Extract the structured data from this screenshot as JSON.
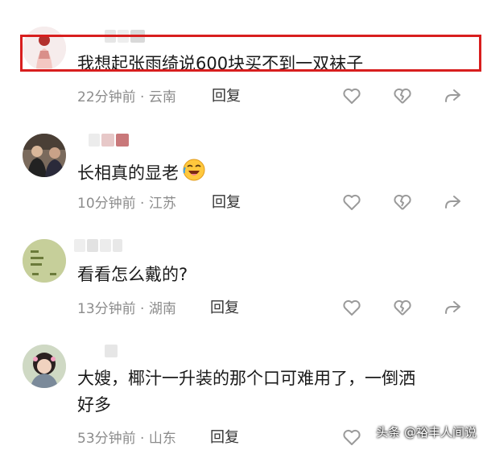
{
  "comments": [
    {
      "text": "我想起张雨绮说600块买不到一双袜子",
      "time": "22分钟前",
      "location": "云南",
      "reply_label": "回复"
    },
    {
      "text": "长相真的显老",
      "emoji": "laughing-crying-emoji",
      "time": "10分钟前",
      "location": "江苏",
      "reply_label": "回复"
    },
    {
      "text": "看看怎么戴的?",
      "time": "13分钟前",
      "location": "湖南",
      "reply_label": "回复"
    },
    {
      "text_line1": "大嫂，椰汁一升装的那个口可难用了，一倒洒",
      "text_line2": "好多",
      "time": "53分钟前",
      "location": "山东",
      "reply_label": "回复"
    }
  ],
  "separator": " · ",
  "watermark": "头条 @裕丰人间说",
  "icons": {
    "like": "heart-icon",
    "dislike": "broken-heart-icon",
    "share": "share-arrow-icon"
  },
  "colors": {
    "highlight": "#d81e1e",
    "meta_text": "#8c8c8c",
    "icon": "#9a9a9a"
  }
}
